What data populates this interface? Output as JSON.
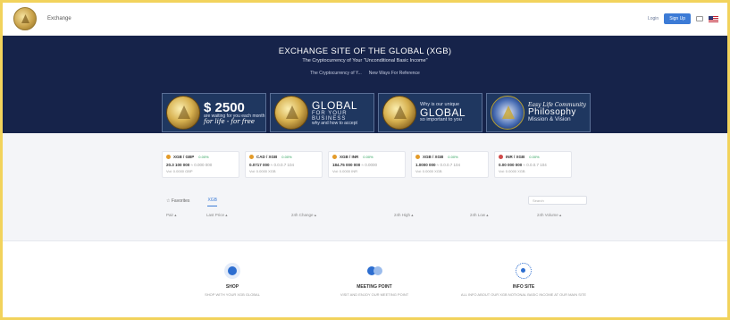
{
  "header": {
    "brand": "Exchange",
    "login_label": "Login",
    "signup_label": "Sign Up"
  },
  "hero": {
    "title": "EXCHANGE SITE OF THE GLOBAL (XGB)",
    "subtitle": "The Cryptocurrency of Your \"Unconditional Basic Income\"",
    "link1": "The Cryptocurrency of Y...",
    "link2": "New Ways For Reference"
  },
  "banners": [
    {
      "big": "$ 2500",
      "small": "are waiting for you each month",
      "script": "for life - for free"
    },
    {
      "big": "GLOBAL",
      "mid": "FOR YOUR",
      "mid2": "BUSINESS",
      "small": "why and how to accept"
    },
    {
      "small": "Why is our unique",
      "big": "GLOBAL",
      "script": "so important to you"
    },
    {
      "script": "Easy Life Community",
      "big": "Philosophy",
      "mid": "Mission & Vision"
    }
  ],
  "markets": [
    {
      "pair": "XGB / GBP",
      "change": "0.00%",
      "price": "20.3 100 000",
      "fiat": "≈ 0.000 000",
      "volume": "Vol: 0.0000 GBP"
    },
    {
      "pair": "CAD / XGB",
      "change": "0.00%",
      "price": "0.0717 000",
      "fiat": "≈ 0.0.0.7 104",
      "volume": "Vol: 0.0000 XGB"
    },
    {
      "pair": "XGB / INR",
      "change": "0.00%",
      "price": "184.75 000 000",
      "fiat": "≈ 0.0000",
      "volume": "Vol: 0.0000 INR"
    },
    {
      "pair": "XGB / XGB",
      "change": "0.00%",
      "price": "1.0000 000",
      "fiat": "≈ 0.0.0.7 104",
      "volume": "Vol: 0.0000 XGB"
    },
    {
      "pair": "INR / XGB",
      "change": "0.00%",
      "price": "0.00 000 000",
      "fiat": "≈ 0.0.0.7 104",
      "volume": "Vol: 0.0000 XGB"
    }
  ],
  "tabs": {
    "favorites": "☆ Favorites",
    "xgb": "XGB"
  },
  "search_placeholder": "Search",
  "table_headers": [
    "Pair ▴",
    "Last Price ▴",
    "24h Change ▴",
    "24h High ▴",
    "24h Low ▴",
    "24h Volume ▴"
  ],
  "features": [
    {
      "title": "SHOP",
      "desc": "SHOP WITH YOUR XGB GLOBAL",
      "icon": "shop-icon"
    },
    {
      "title": "MEETING POINT",
      "desc": "VISIT AND ENJOY OUR MEETING POINT",
      "icon": "meeting-point-icon"
    },
    {
      "title": "INFO SITE",
      "desc": "ALL INFO ABOUT OUR XGB NOTIONAL BASIC INCOME AT OUR MAIN SITE",
      "icon": "info-site-icon"
    }
  ],
  "colors": {
    "hero_bg": "#16234a",
    "accent": "#3c7bd6",
    "coin_gold": "#d7b150",
    "frame_border": "#f2d35c"
  }
}
